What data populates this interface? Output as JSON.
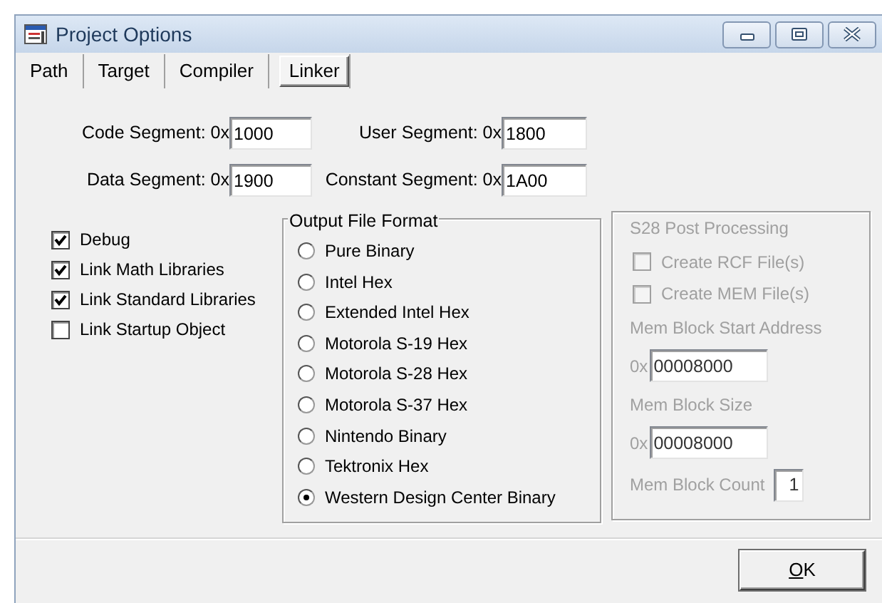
{
  "window": {
    "title": "Project Options"
  },
  "tabs": [
    {
      "label": "Path",
      "selected": false
    },
    {
      "label": "Target",
      "selected": false
    },
    {
      "label": "Compiler",
      "selected": false
    },
    {
      "label": "Linker",
      "selected": true
    }
  ],
  "segments": [
    {
      "label": "Code Segment: 0x",
      "value": "1000"
    },
    {
      "label": "User Segment: 0x",
      "value": "1800"
    },
    {
      "label": "Data Segment: 0x",
      "value": "1900"
    },
    {
      "label": "Constant Segment: 0x",
      "value": "1A00"
    }
  ],
  "options": [
    {
      "label": "Debug",
      "checked": true
    },
    {
      "label": "Link Math Libraries",
      "checked": true
    },
    {
      "label": "Link Standard Libraries",
      "checked": true
    },
    {
      "label": "Link Startup Object",
      "checked": false
    }
  ],
  "output_format": {
    "title": "Output File Format",
    "choices": [
      {
        "label": "Pure Binary",
        "selected": false
      },
      {
        "label": "Intel Hex",
        "selected": false
      },
      {
        "label": "Extended Intel Hex",
        "selected": false
      },
      {
        "label": "Motorola S-19 Hex",
        "selected": false
      },
      {
        "label": "Motorola S-28 Hex",
        "selected": false
      },
      {
        "label": "Motorola S-37 Hex",
        "selected": false
      },
      {
        "label": "Nintendo Binary",
        "selected": false
      },
      {
        "label": "Tektronix Hex",
        "selected": false
      },
      {
        "label": "Western Design Center Binary",
        "selected": true
      }
    ]
  },
  "s28": {
    "title": "S28 Post Processing",
    "disabled": true,
    "items": [
      {
        "kind": "checkbox",
        "label": "Create RCF File(s)",
        "checked": false
      },
      {
        "kind": "checkbox",
        "label": "Create MEM File(s)",
        "checked": false
      },
      {
        "kind": "label",
        "label": "Mem Block Start Address"
      },
      {
        "kind": "hex_field",
        "prefix": "0x",
        "value": "00008000"
      },
      {
        "kind": "label",
        "label": "Mem Block Size"
      },
      {
        "kind": "hex_field",
        "prefix": "0x",
        "value": "00008000"
      },
      {
        "kind": "count_field",
        "label": "Mem Block Count",
        "value": "1"
      }
    ]
  },
  "buttons": [
    {
      "label": "OK",
      "first_letter_underlined": true
    }
  ]
}
